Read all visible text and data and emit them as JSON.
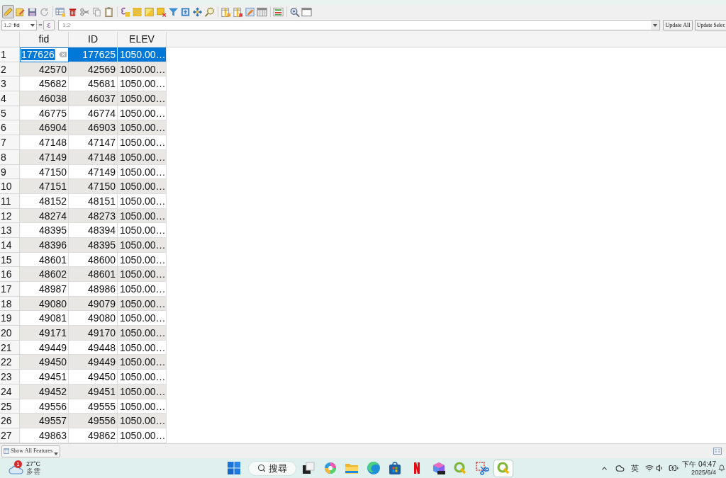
{
  "toolbar": {
    "groups": [
      {
        "buttons": [
          {
            "kind": "pencil",
            "pressed": true
          },
          {
            "kind": "notebook",
            "pressed": false
          },
          {
            "kind": "floppy",
            "pressed": false
          },
          {
            "kind": "refresh",
            "pressed": false
          }
        ]
      },
      {
        "buttons": [
          {
            "kind": "addrow",
            "pressed": false
          },
          {
            "kind": "trash",
            "pressed": false
          },
          {
            "kind": "scissors",
            "pressed": false
          },
          {
            "kind": "copy",
            "pressed": false
          },
          {
            "kind": "clipboard",
            "pressed": false
          }
        ]
      },
      {
        "buttons": [
          {
            "kind": "epsilon",
            "pressed": false
          },
          {
            "kind": "rows",
            "pressed": false
          },
          {
            "kind": "invert",
            "pressed": false
          },
          {
            "kind": "deselect",
            "pressed": false
          },
          {
            "kind": "funnel",
            "pressed": false
          },
          {
            "kind": "totop",
            "pressed": false
          },
          {
            "kind": "pan",
            "pressed": false
          },
          {
            "kind": "magnifier",
            "pressed": false
          }
        ]
      },
      {
        "buttons": [
          {
            "kind": "newfield",
            "pressed": false
          },
          {
            "kind": "delfield",
            "pressed": false
          },
          {
            "kind": "calculator",
            "pressed": false
          },
          {
            "kind": "grid",
            "pressed": false
          }
        ]
      },
      {
        "buttons": [
          {
            "kind": "dock",
            "pressed": false
          }
        ]
      },
      {
        "buttons": [
          {
            "kind": "gearsearch",
            "pressed": false
          },
          {
            "kind": "window",
            "pressed": false
          }
        ]
      }
    ]
  },
  "field_calculator_bar": {
    "field_type": "1.2",
    "field": "fid",
    "operator": "=",
    "expression_button": "ε",
    "expression_type": "1.2",
    "buttons": [
      "Update All",
      "Update Selec"
    ]
  },
  "table": {
    "columns": [
      {
        "name": "fid",
        "kind": "number"
      },
      {
        "name": "ID",
        "kind": "number"
      },
      {
        "name": "ELEV",
        "kind": "text"
      }
    ],
    "rows": [
      {
        "number": "1",
        "cells": [
          "177626",
          "177625",
          "1050.00…"
        ],
        "selected": true,
        "editing": true
      },
      {
        "number": "2",
        "cells": [
          "42570",
          "42569",
          "1050.00…"
        ],
        "selected": false,
        "editing": false
      },
      {
        "number": "3",
        "cells": [
          "45682",
          "45681",
          "1050.00…"
        ],
        "selected": false,
        "editing": false
      },
      {
        "number": "4",
        "cells": [
          "46038",
          "46037",
          "1050.00…"
        ],
        "selected": false,
        "editing": false
      },
      {
        "number": "5",
        "cells": [
          "46775",
          "46774",
          "1050.00…"
        ],
        "selected": false,
        "editing": false
      },
      {
        "number": "6",
        "cells": [
          "46904",
          "46903",
          "1050.00…"
        ],
        "selected": false,
        "editing": false
      },
      {
        "number": "7",
        "cells": [
          "47148",
          "47147",
          "1050.00…"
        ],
        "selected": false,
        "editing": false
      },
      {
        "number": "8",
        "cells": [
          "47149",
          "47148",
          "1050.00…"
        ],
        "selected": false,
        "editing": false
      },
      {
        "number": "9",
        "cells": [
          "47150",
          "47149",
          "1050.00…"
        ],
        "selected": false,
        "editing": false
      },
      {
        "number": "10",
        "cells": [
          "47151",
          "47150",
          "1050.00…"
        ],
        "selected": false,
        "editing": false
      },
      {
        "number": "11",
        "cells": [
          "48152",
          "48151",
          "1050.00…"
        ],
        "selected": false,
        "editing": false
      },
      {
        "number": "12",
        "cells": [
          "48274",
          "48273",
          "1050.00…"
        ],
        "selected": false,
        "editing": false
      },
      {
        "number": "13",
        "cells": [
          "48395",
          "48394",
          "1050.00…"
        ],
        "selected": false,
        "editing": false
      },
      {
        "number": "14",
        "cells": [
          "48396",
          "48395",
          "1050.00…"
        ],
        "selected": false,
        "editing": false
      },
      {
        "number": "15",
        "cells": [
          "48601",
          "48600",
          "1050.00…"
        ],
        "selected": false,
        "editing": false
      },
      {
        "number": "16",
        "cells": [
          "48602",
          "48601",
          "1050.00…"
        ],
        "selected": false,
        "editing": false
      },
      {
        "number": "17",
        "cells": [
          "48987",
          "48986",
          "1050.00…"
        ],
        "selected": false,
        "editing": false
      },
      {
        "number": "18",
        "cells": [
          "49080",
          "49079",
          "1050.00…"
        ],
        "selected": false,
        "editing": false
      },
      {
        "number": "19",
        "cells": [
          "49081",
          "49080",
          "1050.00…"
        ],
        "selected": false,
        "editing": false
      },
      {
        "number": "20",
        "cells": [
          "49171",
          "49170",
          "1050.00…"
        ],
        "selected": false,
        "editing": false
      },
      {
        "number": "21",
        "cells": [
          "49449",
          "49448",
          "1050.00…"
        ],
        "selected": false,
        "editing": false
      },
      {
        "number": "22",
        "cells": [
          "49450",
          "49449",
          "1050.00…"
        ],
        "selected": false,
        "editing": false
      },
      {
        "number": "23",
        "cells": [
          "49451",
          "49450",
          "1050.00…"
        ],
        "selected": false,
        "editing": false
      },
      {
        "number": "24",
        "cells": [
          "49452",
          "49451",
          "1050.00…"
        ],
        "selected": false,
        "editing": false
      },
      {
        "number": "25",
        "cells": [
          "49556",
          "49555",
          "1050.00…"
        ],
        "selected": false,
        "editing": false
      },
      {
        "number": "26",
        "cells": [
          "49557",
          "49556",
          "1050.00…"
        ],
        "selected": false,
        "editing": false
      },
      {
        "number": "27",
        "cells": [
          "49863",
          "49862",
          "1050.00…"
        ],
        "selected": false,
        "editing": false
      }
    ]
  },
  "bottom_bar": {
    "filter_button": "Show All Features"
  },
  "taskbar": {
    "weather": {
      "badge": "1",
      "temperature": "27°C",
      "condition": "多雲"
    },
    "search": {
      "label": "搜尋"
    },
    "apps": [
      {
        "kind": "taskview",
        "selected": false
      },
      {
        "kind": "swirl",
        "selected": false
      },
      {
        "kind": "folder",
        "selected": false
      },
      {
        "kind": "browser",
        "selected": false
      },
      {
        "kind": "store",
        "selected": false
      },
      {
        "kind": "nlogo",
        "selected": false
      },
      {
        "kind": "cube",
        "selected": false
      },
      {
        "kind": "ring",
        "selected": false
      },
      {
        "kind": "snip",
        "selected": false
      },
      {
        "kind": "ring",
        "selected": true
      }
    ],
    "tray": {
      "language": "英",
      "time": "下午 04:47",
      "date": "2025/6/4"
    }
  }
}
